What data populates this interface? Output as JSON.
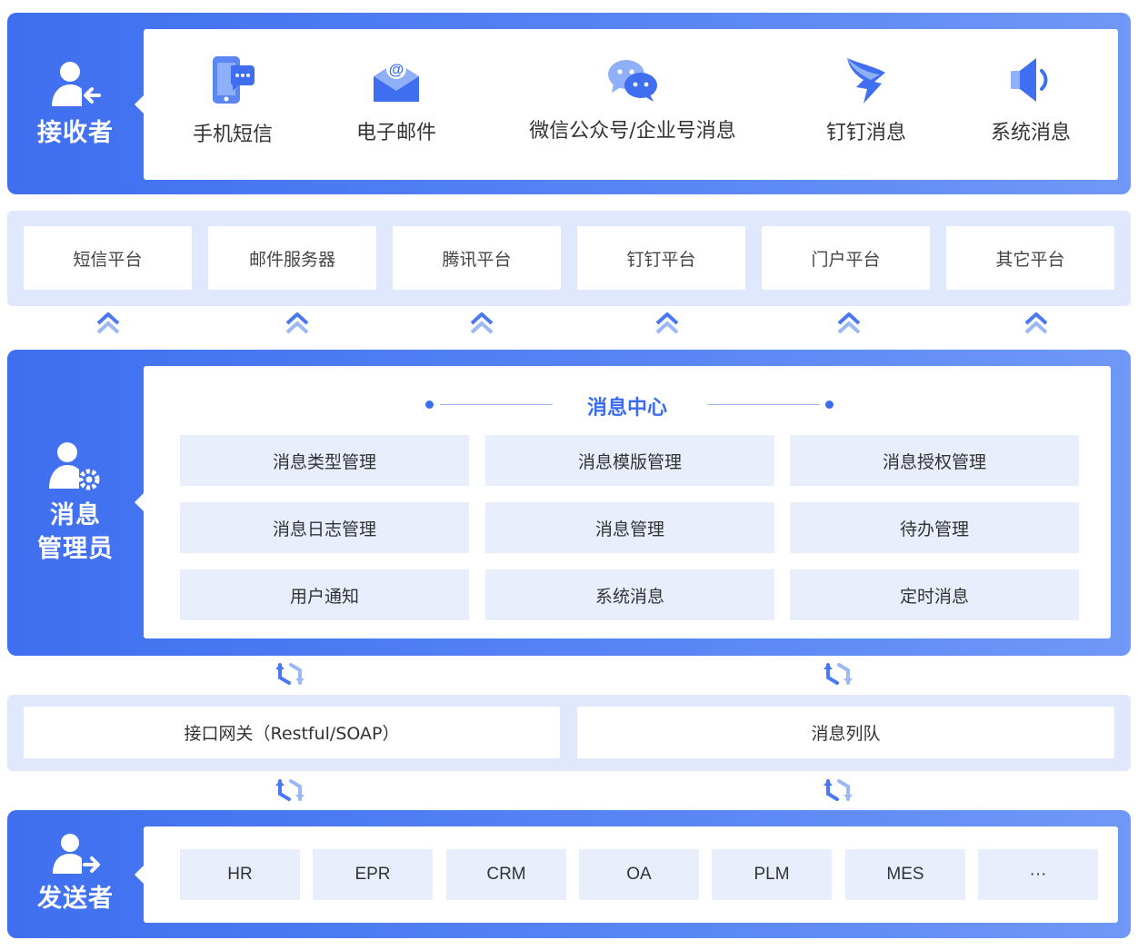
{
  "receiver": {
    "label": "接收者",
    "channels": [
      {
        "label": "手机短信",
        "icon": "mobile-sms-icon"
      },
      {
        "label": "电子邮件",
        "icon": "email-icon"
      },
      {
        "label": "微信公众号/企业号消息",
        "icon": "wechat-icon"
      },
      {
        "label": "钉钉消息",
        "icon": "dingtalk-icon"
      },
      {
        "label": "系统消息",
        "icon": "speaker-icon"
      }
    ]
  },
  "platforms": [
    "短信平台",
    "邮件服务器",
    "腾讯平台",
    "钉钉平台",
    "门户平台",
    "其它平台"
  ],
  "admin": {
    "label_line1": "消息",
    "label_line2": "管理员",
    "center_title": "消息中心",
    "modules": [
      "消息类型管理",
      "消息模版管理",
      "消息授权管理",
      "消息日志管理",
      "消息管理",
      "待办管理",
      "用户通知",
      "系统消息",
      "定时消息"
    ]
  },
  "gateway": {
    "left": "接口网关（Restful/SOAP）",
    "right": "消息列队"
  },
  "sender": {
    "label": "发送者",
    "systems": [
      "HR",
      "EPR",
      "CRM",
      "OA",
      "PLM",
      "MES",
      "···"
    ]
  },
  "colors": {
    "primary": "#3f6ff0",
    "light_band": "#dfe8fc",
    "module_bg": "#e8eefc",
    "title_blue": "#3a6cf0"
  }
}
